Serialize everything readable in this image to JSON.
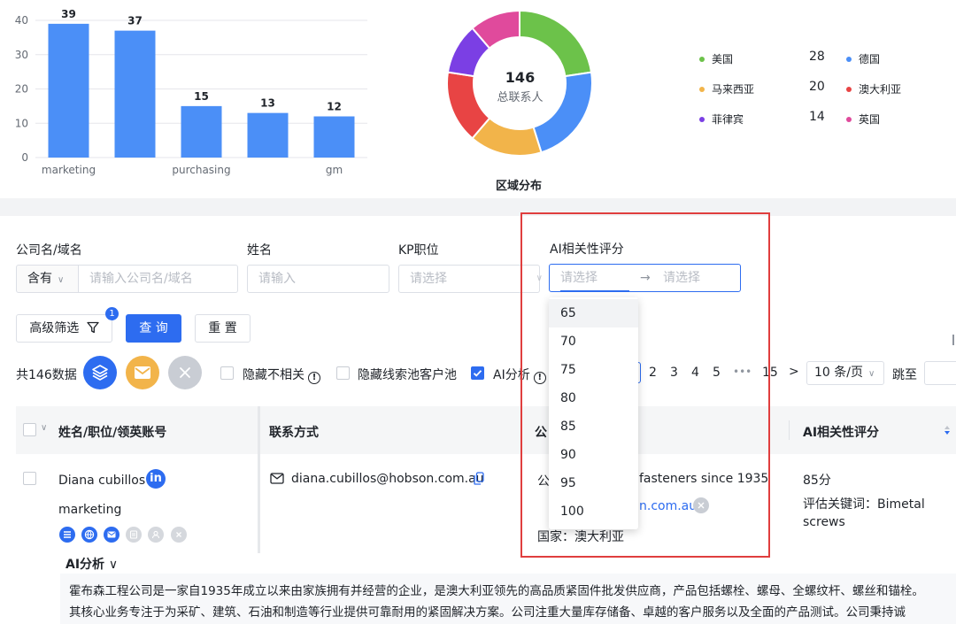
{
  "chart_data": [
    {
      "type": "bar",
      "categories": [
        "marketing",
        "",
        "purchasing",
        "",
        "gm"
      ],
      "values": [
        39,
        37,
        15,
        13,
        12
      ],
      "ylim": [
        0,
        40
      ],
      "yticks": [
        0,
        10,
        20,
        30,
        40
      ],
      "grid": true,
      "color": "#4b8ff7"
    },
    {
      "type": "pie",
      "title": "区域分布",
      "center_value": "146",
      "center_label": "总联系人",
      "slices": [
        {
          "name": "美国",
          "value": 28,
          "color": "#6cc24a"
        },
        {
          "name": "德国",
          "value": 28,
          "color": "#4b8ff7"
        },
        {
          "name": "马来西亚",
          "value": 20,
          "color": "#f2b44a"
        },
        {
          "name": "澳大利亚",
          "value": 20,
          "color": "#e84444"
        },
        {
          "name": "菲律宾",
          "value": 14,
          "color": "#7b3fe4"
        },
        {
          "name": "英国",
          "value": 14,
          "color": "#e04a9c"
        }
      ]
    }
  ],
  "legend": [
    {
      "name": "美国",
      "value": "28",
      "color": "#6cc24a"
    },
    {
      "name": "德国",
      "value": "",
      "color": "#4b8ff7"
    },
    {
      "name": "马来西亚",
      "value": "20",
      "color": "#f2b44a"
    },
    {
      "name": "澳大利亚",
      "value": "",
      "color": "#e84444"
    },
    {
      "name": "菲律宾",
      "value": "14",
      "color": "#7b3fe4"
    },
    {
      "name": "英国",
      "value": "",
      "color": "#e04a9c"
    }
  ],
  "filters": {
    "company_label": "公司名/域名",
    "match_value": "含有",
    "company_placeholder": "请输入公司名/域名",
    "name_label": "姓名",
    "name_placeholder": "请输入",
    "kp_label": "KP职位",
    "kp_placeholder": "请选择",
    "ai_label": "AI相关性评分",
    "ai_from_placeholder": "请选择",
    "ai_arrow": "→",
    "ai_to_placeholder": "请选择"
  },
  "buttons": {
    "advanced": "高级筛选",
    "advanced_badge": "1",
    "query": "查 询",
    "reset": "重 置"
  },
  "toolbar": {
    "total": "共146数据",
    "hide_irrelevant": "隐藏不相关",
    "hide_pool": "隐藏线索池客户池",
    "ai_analysis": "AI分析"
  },
  "pagination": {
    "pages": [
      "2",
      "3",
      "4",
      "5"
    ],
    "ellipsis": "•••",
    "last": "15",
    "next": ">",
    "page_size": "10 条/页",
    "jump": "跳至"
  },
  "dropdown": {
    "options": [
      "65",
      "70",
      "75",
      "80",
      "85",
      "90",
      "95",
      "100"
    ],
    "active": 0
  },
  "table": {
    "headers": {
      "name": "姓名/职位/领英账号",
      "contact": "联系方式",
      "company": "公",
      "ai_score": "AI相关性评分"
    },
    "row": {
      "name": "Diana cubillos",
      "title": "marketing",
      "email": "diana.cubillos@hobson.com.au",
      "company_partial": "公",
      "company_desc_partial": "fasteners since 1935",
      "website_partial": "n.com.au",
      "country": "国家：澳大利亚",
      "score": "85分",
      "keywords_line1": "评估关键词：Bimetal",
      "keywords_line2": "screws"
    }
  },
  "ai_analysis": {
    "toggle": "AI分析",
    "line1": "霍布森工程公司是一家自1935年成立以来由家族拥有并经营的企业，是澳大利亚领先的高品质紧固件批发供应商，产品包括螺栓、螺母、全螺纹杆、螺丝和锚栓。",
    "line2": "其核心业务专注于为采矿、建筑、石油和制造等行业提供可靠耐用的紧固解决方案。公司注重大量库存储备、卓越的客户服务以及全面的产品测试。公司秉持诚"
  }
}
